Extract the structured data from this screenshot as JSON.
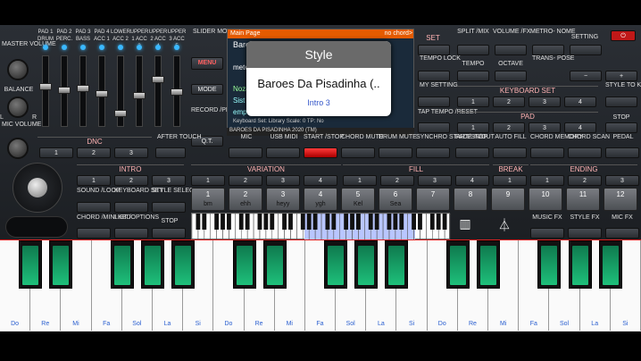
{
  "top_left": {
    "master_volume": "MASTER VOLUME",
    "balance": "BALANCE",
    "mic_volume": "MIC VOLUME",
    "pads": [
      "PAD 1 DRUM",
      "PAD 2 PERC.",
      "PAD 3 BASS",
      "PAD 4 ACC 1",
      "LOWER ACC 2",
      "UPPER 1 ACC 3",
      "UPPER 2 ACC 4",
      "UPPER 3 ACC 5"
    ],
    "slider_mode": "SLIDER MODE",
    "menu": "MENU",
    "mode": "MODE",
    "record_play": "RECORD /PLAY",
    "qt": "Q.T.",
    "dnc": "DNC",
    "after_touch": "AFTER TOUCH",
    "dnc_buttons": [
      "1",
      "2",
      "3"
    ],
    "bal_l": "L",
    "bal_r": "R"
  },
  "display": {
    "title": "Main Page",
    "chord": "no chord>",
    "song_line": "BAROES DA PISADINHA 2020 (TM)",
    "background_lines": [
      "Baroes Da Pisadinha (..",
      "meter",
      "Noza",
      "Sist",
      "empty",
      "Keyboard Set: Library    Scale: 0    TP: No"
    ]
  },
  "popup": {
    "title": "Style",
    "name": "Baroes Da Pisadinha (..",
    "sub": "Intro 3"
  },
  "right": {
    "set": "SET",
    "split_mix": "SPLIT /MIX",
    "volume_fx": "VOLUME /FX",
    "metronome": "METRO- NOME",
    "setting": "SETTING",
    "tempo_lock": "TEMPO LOCK",
    "tempo": "TEMPO",
    "octave": "OCTAVE",
    "transpose": "TRANS- POSE",
    "my_setting": "MY SETTING",
    "keyboard_set": "KEYBOARD SET",
    "style_to_kbd": "STYLE TO KBD SET",
    "tap_tempo": "TAP TEMPO /RESET",
    "pad": "PAD",
    "stop": "STOP",
    "minus": "−",
    "plus": "+",
    "kbd_nums": [
      "1",
      "2",
      "3",
      "4"
    ],
    "pad_nums": [
      "1",
      "2",
      "3",
      "4"
    ]
  },
  "row_mid": {
    "mic": "MIC",
    "usb_midi": "USB MIDI",
    "start_stop": "START /STOP",
    "chord_mute": "CHORD MUTE",
    "drum_mute": "DRUM MUTE",
    "synchro": "SYNCHRO START/STOP",
    "fade": "FADE IN/OUT",
    "auto_fill": "AUTO FILL",
    "chord_memory": "CHORD MEMORY",
    "chord_scan": "CHORD SCAN",
    "pedal": "PEDAL"
  },
  "sections": {
    "intro": "INTRO",
    "variation": "VARIATION",
    "fill": "FILL",
    "break": "BREAK",
    "ending": "ENDING",
    "intro_nums": [
      "1",
      "2",
      "3"
    ],
    "var_nums": [
      "1",
      "2",
      "3",
      "4"
    ],
    "fill_nums": [
      "1",
      "2",
      "3",
      "4"
    ],
    "break_nums": [
      "1"
    ],
    "ending_nums": [
      "1",
      "2",
      "3"
    ]
  },
  "left_lower": {
    "sound_loop": "SOUND /LOOP",
    "keyboard_set": "KEYBOARD SET",
    "style_select": "STYLE SELECT",
    "chord_mini_kbd": "CHORD /MINI KBD",
    "list_options": "LIST /OPTIONS",
    "stop": "STOP"
  },
  "pads": [
    {
      "n": "1",
      "t": "bm"
    },
    {
      "n": "2",
      "t": "ehh"
    },
    {
      "n": "3",
      "t": "heyy"
    },
    {
      "n": "4",
      "t": "ygh"
    },
    {
      "n": "5",
      "t": "Kel"
    },
    {
      "n": "6",
      "t": "Sea"
    },
    {
      "n": "7",
      "t": ""
    },
    {
      "n": "8",
      "t": ""
    },
    {
      "n": "9",
      "t": ""
    },
    {
      "n": "10",
      "t": ""
    },
    {
      "n": "11",
      "t": ""
    },
    {
      "n": "12",
      "t": ""
    }
  ],
  "fx": {
    "music_fx": "MUSIC FX",
    "style_fx": "STYLE FX",
    "mic_fx": "MIC FX"
  },
  "notes": [
    "Do",
    "Re",
    "Mi",
    "Fa",
    "Sol",
    "La",
    "Si",
    "Do",
    "Re",
    "Mi",
    "Fa",
    "Sol",
    "La",
    "Si",
    "Do",
    "Re",
    "Mi",
    "Fa",
    "Sol",
    "La",
    "Si"
  ],
  "colors": {
    "accent_red": "#e02020",
    "led_blue": "#3ab8ff",
    "key_green": "#1ec07a"
  }
}
